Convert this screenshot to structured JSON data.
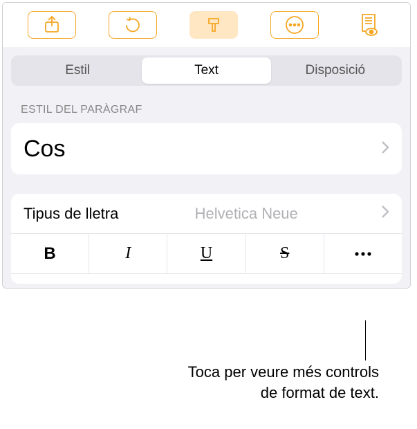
{
  "toolbar": {
    "share": "share-icon",
    "undo": "undo-icon",
    "format": "format-brush-icon",
    "more": "more-icon",
    "read": "read-mode-icon"
  },
  "tabs": {
    "style": "Estil",
    "text": "Text",
    "layout": "Disposició"
  },
  "section_labels": {
    "paragraph_style": "ESTIL DEL PARÀGRAF"
  },
  "paragraph_style": {
    "value": "Cos"
  },
  "font_row": {
    "label": "Tipus de lletra",
    "value": "Helvetica Neue"
  },
  "style_buttons": {
    "bold": "B",
    "italic": "I",
    "underline": "U",
    "strike": "S",
    "more": "more-options"
  },
  "callout": {
    "line1": "Toca per veure més controls",
    "line2": "de format de text."
  }
}
